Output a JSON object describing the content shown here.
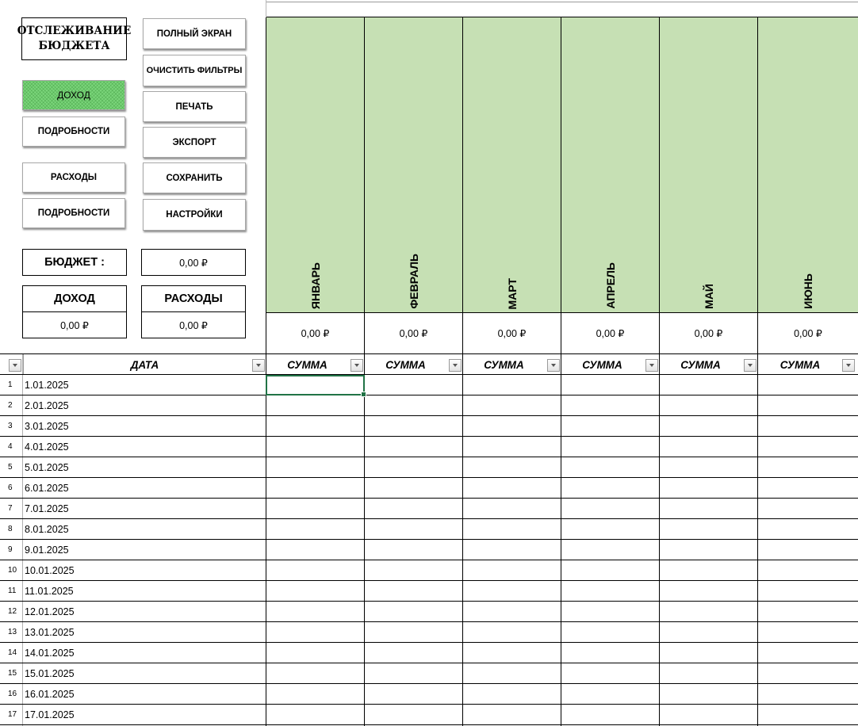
{
  "dashboard": {
    "title": "ОТСЛЕЖИВАНИЕ\nБЮДЖЕТА",
    "left_buttons": {
      "income": "ДОХОД",
      "income_details": "ПОДРОБНОСТИ",
      "expenses": "РАСХОДЫ",
      "expenses_details": "ПОДРОБНОСТИ"
    },
    "right_buttons": {
      "fullscreen": "ПОЛНЫЙ ЭКРАН",
      "clear_filters": "ОЧИСТИТЬ ФИЛЬТРЫ",
      "print": "ПЕЧАТЬ",
      "export": "ЭКСПОРТ",
      "save": "СОХРАНИТЬ",
      "settings": "НАСТРОЙКИ"
    },
    "active_button": "income",
    "active_color": "#7bd67b",
    "budget_label": "БЮДЖЕТ :",
    "budget_value": "0,00 ₽",
    "income_label": "ДОХОД",
    "income_value": "0,00 ₽",
    "expenses_label": "РАСХОДЫ",
    "expenses_value": "0,00 ₽"
  },
  "months": [
    {
      "name": "ЯНВАРЬ",
      "total": "0,00 ₽"
    },
    {
      "name": "ФЕВРАЛЬ",
      "total": "0,00 ₽"
    },
    {
      "name": "МАРТ",
      "total": "0,00 ₽"
    },
    {
      "name": "АПРЕЛЬ",
      "total": "0,00 ₽"
    },
    {
      "name": "МАЙ",
      "total": "0,00 ₽"
    },
    {
      "name": "ИЮНЬ",
      "total": "0,00 ₽"
    }
  ],
  "month_header_color": "#c6e0b4",
  "table": {
    "date_header": "ДАТА",
    "amount_header": "СУММА",
    "rows": [
      {
        "num": "1",
        "date": "1.01.2025"
      },
      {
        "num": "2",
        "date": "2.01.2025"
      },
      {
        "num": "3",
        "date": "3.01.2025"
      },
      {
        "num": "4",
        "date": "4.01.2025"
      },
      {
        "num": "5",
        "date": "5.01.2025"
      },
      {
        "num": "6",
        "date": "6.01.2025"
      },
      {
        "num": "7",
        "date": "7.01.2025"
      },
      {
        "num": "8",
        "date": "8.01.2025"
      },
      {
        "num": "9",
        "date": "9.01.2025"
      },
      {
        "num": "10",
        "date": "10.01.2025"
      },
      {
        "num": "11",
        "date": "11.01.2025"
      },
      {
        "num": "12",
        "date": "12.01.2025"
      },
      {
        "num": "13",
        "date": "13.01.2025"
      },
      {
        "num": "14",
        "date": "14.01.2025"
      },
      {
        "num": "15",
        "date": "15.01.2025"
      },
      {
        "num": "16",
        "date": "16.01.2025"
      },
      {
        "num": "17",
        "date": "17.01.2025"
      }
    ]
  },
  "selection_color": "#217346"
}
